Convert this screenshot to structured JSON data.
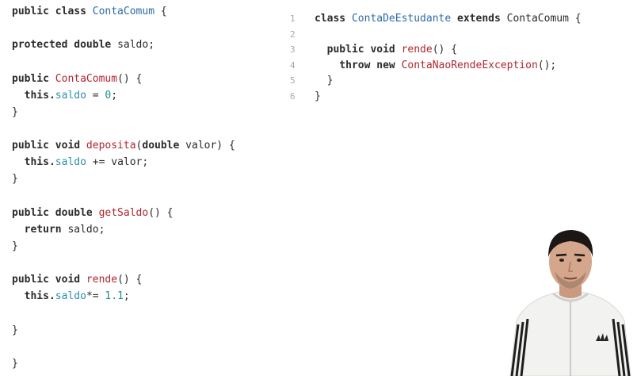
{
  "left_code": {
    "lines": [
      [
        {
          "t": "public class ",
          "c": "kw"
        },
        {
          "t": "ContaComum",
          "c": "type"
        },
        {
          "t": " {",
          "c": "plain"
        }
      ],
      [],
      [
        {
          "t": "protected double ",
          "c": "kw"
        },
        {
          "t": "saldo;",
          "c": "plain"
        }
      ],
      [],
      [
        {
          "t": "public ",
          "c": "kw"
        },
        {
          "t": "ContaComum",
          "c": "fn"
        },
        {
          "t": "() {",
          "c": "plain"
        }
      ],
      [
        {
          "t": "  this.",
          "c": "kw"
        },
        {
          "t": "saldo",
          "c": "field"
        },
        {
          "t": " = ",
          "c": "plain"
        },
        {
          "t": "0",
          "c": "num"
        },
        {
          "t": ";",
          "c": "plain"
        }
      ],
      [
        {
          "t": "}",
          "c": "plain"
        }
      ],
      [],
      [
        {
          "t": "public void ",
          "c": "kw"
        },
        {
          "t": "deposita",
          "c": "fn"
        },
        {
          "t": "(",
          "c": "plain"
        },
        {
          "t": "double",
          "c": "kw"
        },
        {
          "t": " valor) {",
          "c": "plain"
        }
      ],
      [
        {
          "t": "  this.",
          "c": "kw"
        },
        {
          "t": "saldo",
          "c": "field"
        },
        {
          "t": " += valor;",
          "c": "plain"
        }
      ],
      [
        {
          "t": "}",
          "c": "plain"
        }
      ],
      [],
      [
        {
          "t": "public double ",
          "c": "kw"
        },
        {
          "t": "getSaldo",
          "c": "fn"
        },
        {
          "t": "() {",
          "c": "plain"
        }
      ],
      [
        {
          "t": "  return ",
          "c": "kw"
        },
        {
          "t": "saldo;",
          "c": "plain"
        }
      ],
      [
        {
          "t": "}",
          "c": "plain"
        }
      ],
      [],
      [
        {
          "t": "public void ",
          "c": "kw"
        },
        {
          "t": "rende",
          "c": "fn"
        },
        {
          "t": "() {",
          "c": "plain"
        }
      ],
      [
        {
          "t": "  this.",
          "c": "kw"
        },
        {
          "t": "saldo",
          "c": "field"
        },
        {
          "t": "*= ",
          "c": "plain"
        },
        {
          "t": "1.1",
          "c": "num"
        },
        {
          "t": ";",
          "c": "plain"
        }
      ],
      [],
      [
        {
          "t": "}",
          "c": "plain"
        }
      ],
      [],
      [
        {
          "t": "}",
          "c": "plain"
        }
      ]
    ]
  },
  "right_code": {
    "lines": [
      {
        "n": "1",
        "parts": [
          {
            "t": "class ",
            "c": "kw"
          },
          {
            "t": "ContaDeEstudante",
            "c": "type"
          },
          {
            "t": " extends ",
            "c": "kw"
          },
          {
            "t": "ContaComum {",
            "c": "plain"
          }
        ]
      },
      {
        "n": "2",
        "parts": []
      },
      {
        "n": "3",
        "parts": [
          {
            "t": "  public void ",
            "c": "kw"
          },
          {
            "t": "rende",
            "c": "fn"
          },
          {
            "t": "() {",
            "c": "plain"
          }
        ]
      },
      {
        "n": "4",
        "parts": [
          {
            "t": "    throw new ",
            "c": "kw"
          },
          {
            "t": "ContaNaoRendeException",
            "c": "fn"
          },
          {
            "t": "();",
            "c": "plain"
          }
        ]
      },
      {
        "n": "5",
        "parts": [
          {
            "t": "  }",
            "c": "plain"
          }
        ]
      },
      {
        "n": "6",
        "parts": [
          {
            "t": "}",
            "c": "plain"
          }
        ]
      }
    ]
  },
  "colors": {
    "keyword": "#2b2b2b",
    "type": "#2c6aa8",
    "function": "#b0262e",
    "number": "#1e8d8d",
    "field": "#2c8fa8",
    "line_number": "#a8a8a8"
  },
  "presenter": {
    "icon": "person-icon",
    "shirt_logo": "logo-icon"
  }
}
